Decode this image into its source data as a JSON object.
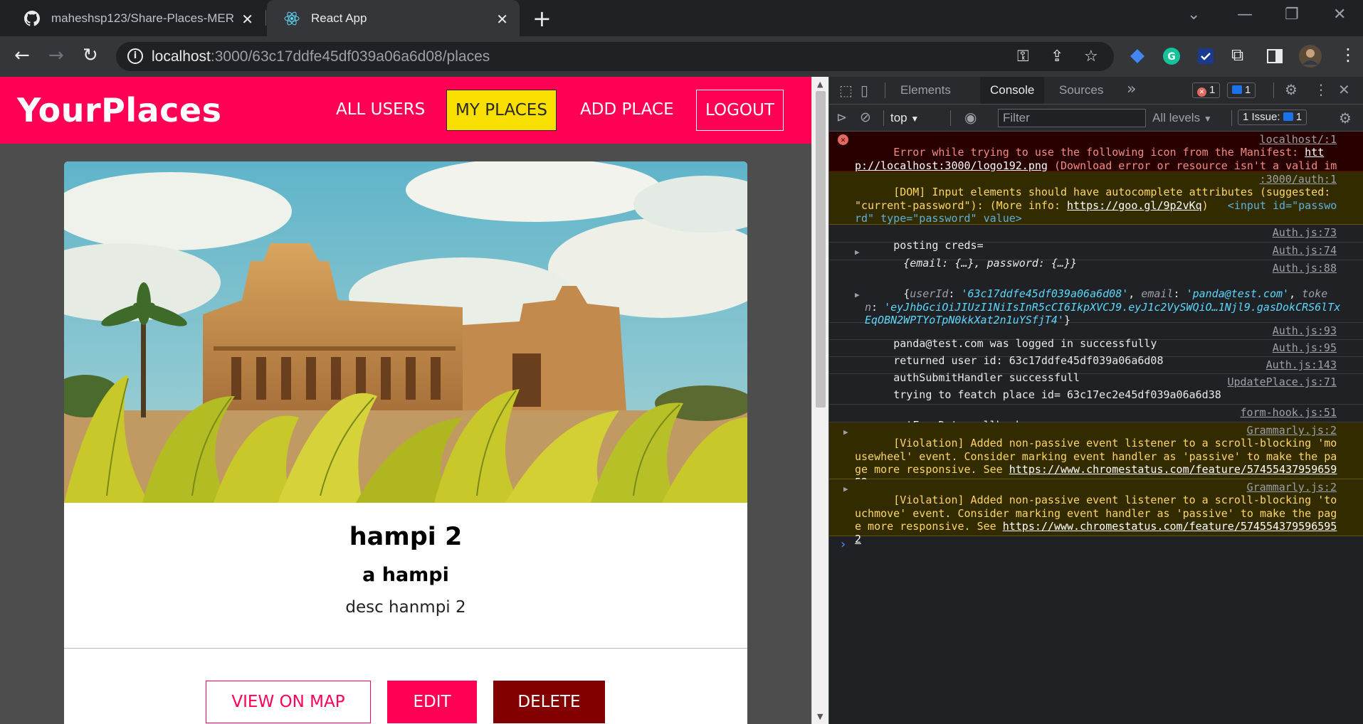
{
  "browser": {
    "tabs": [
      {
        "title": "maheshsp123/Share-Places-MER",
        "active": false
      },
      {
        "title": "React App",
        "active": true
      }
    ],
    "url_host": "localhost",
    "url_path": ":3000/63c17ddfe45df039a06a6d08/places"
  },
  "app": {
    "logo": "YourPlaces",
    "nav": {
      "all_users": "ALL USERS",
      "my_places": "MY PLACES",
      "add_place": "ADD PLACE",
      "logout": "LOGOUT"
    },
    "place": {
      "title": "hampi 2",
      "address": "a hampi",
      "description": "desc hanmpi 2",
      "buttons": {
        "view_on_map": "VIEW ON MAP",
        "edit": "EDIT",
        "delete": "DELETE"
      }
    },
    "colors": {
      "header": "#ff0055",
      "active_nav": "#f8df00",
      "delete": "#830000"
    }
  },
  "devtools": {
    "tabs": {
      "elements": "Elements",
      "console": "Console",
      "sources": "Sources"
    },
    "errors_badge": "1",
    "messages_badge": "1",
    "filter": {
      "context": "top",
      "placeholder": "Filter",
      "levels": "All levels",
      "issues": "1 Issue:",
      "issues_count": "1"
    },
    "console": {
      "error1_text": "Error while trying to use the following icon from the Manifest: ",
      "error1_link": "http://localhost:3000/logo192.png",
      "error1_tail": " (Download error or resource isn't a valid image)",
      "error1_src": "localhost/:1",
      "dom_text": "[DOM] Input elements should have autocomplete attributes (suggested: \"current-password\"): (More info: ",
      "dom_link": "https://goo.gl/9p2vKq",
      "dom_tail": ")",
      "dom_element": "<input id=\"password\" type=\"password\" value>",
      "dom_src": ":3000/auth:1",
      "log1_text": "posting creds=",
      "log1_src": "Auth.js:73",
      "log2_text": "{email: {…}, password: {…}}",
      "log2_src": "Auth.js:74",
      "log3_src": "Auth.js:88",
      "log3_userid_key": "userId",
      "log3_userid_val": "'63c17ddfe45df039a06a6d08'",
      "log3_email_key": "email",
      "log3_email_val": "'panda@test.com'",
      "log3_token_key": "toke",
      "log3_token_key2": "n",
      "log3_token_val": "'eyJhbGciOiJIUzI1NiIsInR5cCI6IkpXVCJ9.eyJ1c2VySWQiO…1Njl9.gasDokCRS6lTxEqOBN2WPTYoTpN0kkXat2n1uYSfjT4'",
      "log4_text": "panda@test.com was logged in successfully",
      "log4_src": "Auth.js:93",
      "log5_text": "returned user id: 63c17ddfe45df039a06a6d08",
      "log5_src": "Auth.js:95",
      "log6_text": "authSubmitHandler successfull",
      "log6_src": "Auth.js:143",
      "log7_text": "trying to featch place id= 63c17ec2e45df039a06a6d38",
      "log7_src": "UpdatePlace.js:71",
      "log8_text": "setFormData callback",
      "log8_src": "form-hook.js:51",
      "warn1_text": "[Violation] Added non-passive event listener to a scroll-blocking 'mousewheel' event. Consider marking event handler as 'passive' to make the page more responsive. See ",
      "warn1_link": "https://www.chromestatus.com/feature/5745543795965952",
      "warn1_src": "Grammarly.js:2",
      "warn2_text": "[Violation] Added non-passive event listener to a scroll-blocking 'touchmove' event. Consider marking event handler as 'passive' to make the page more responsive. See ",
      "warn2_link": "https://www.chromestatus.com/feature/5745543795965952",
      "warn2_src": "Grammarly.js:2"
    }
  }
}
